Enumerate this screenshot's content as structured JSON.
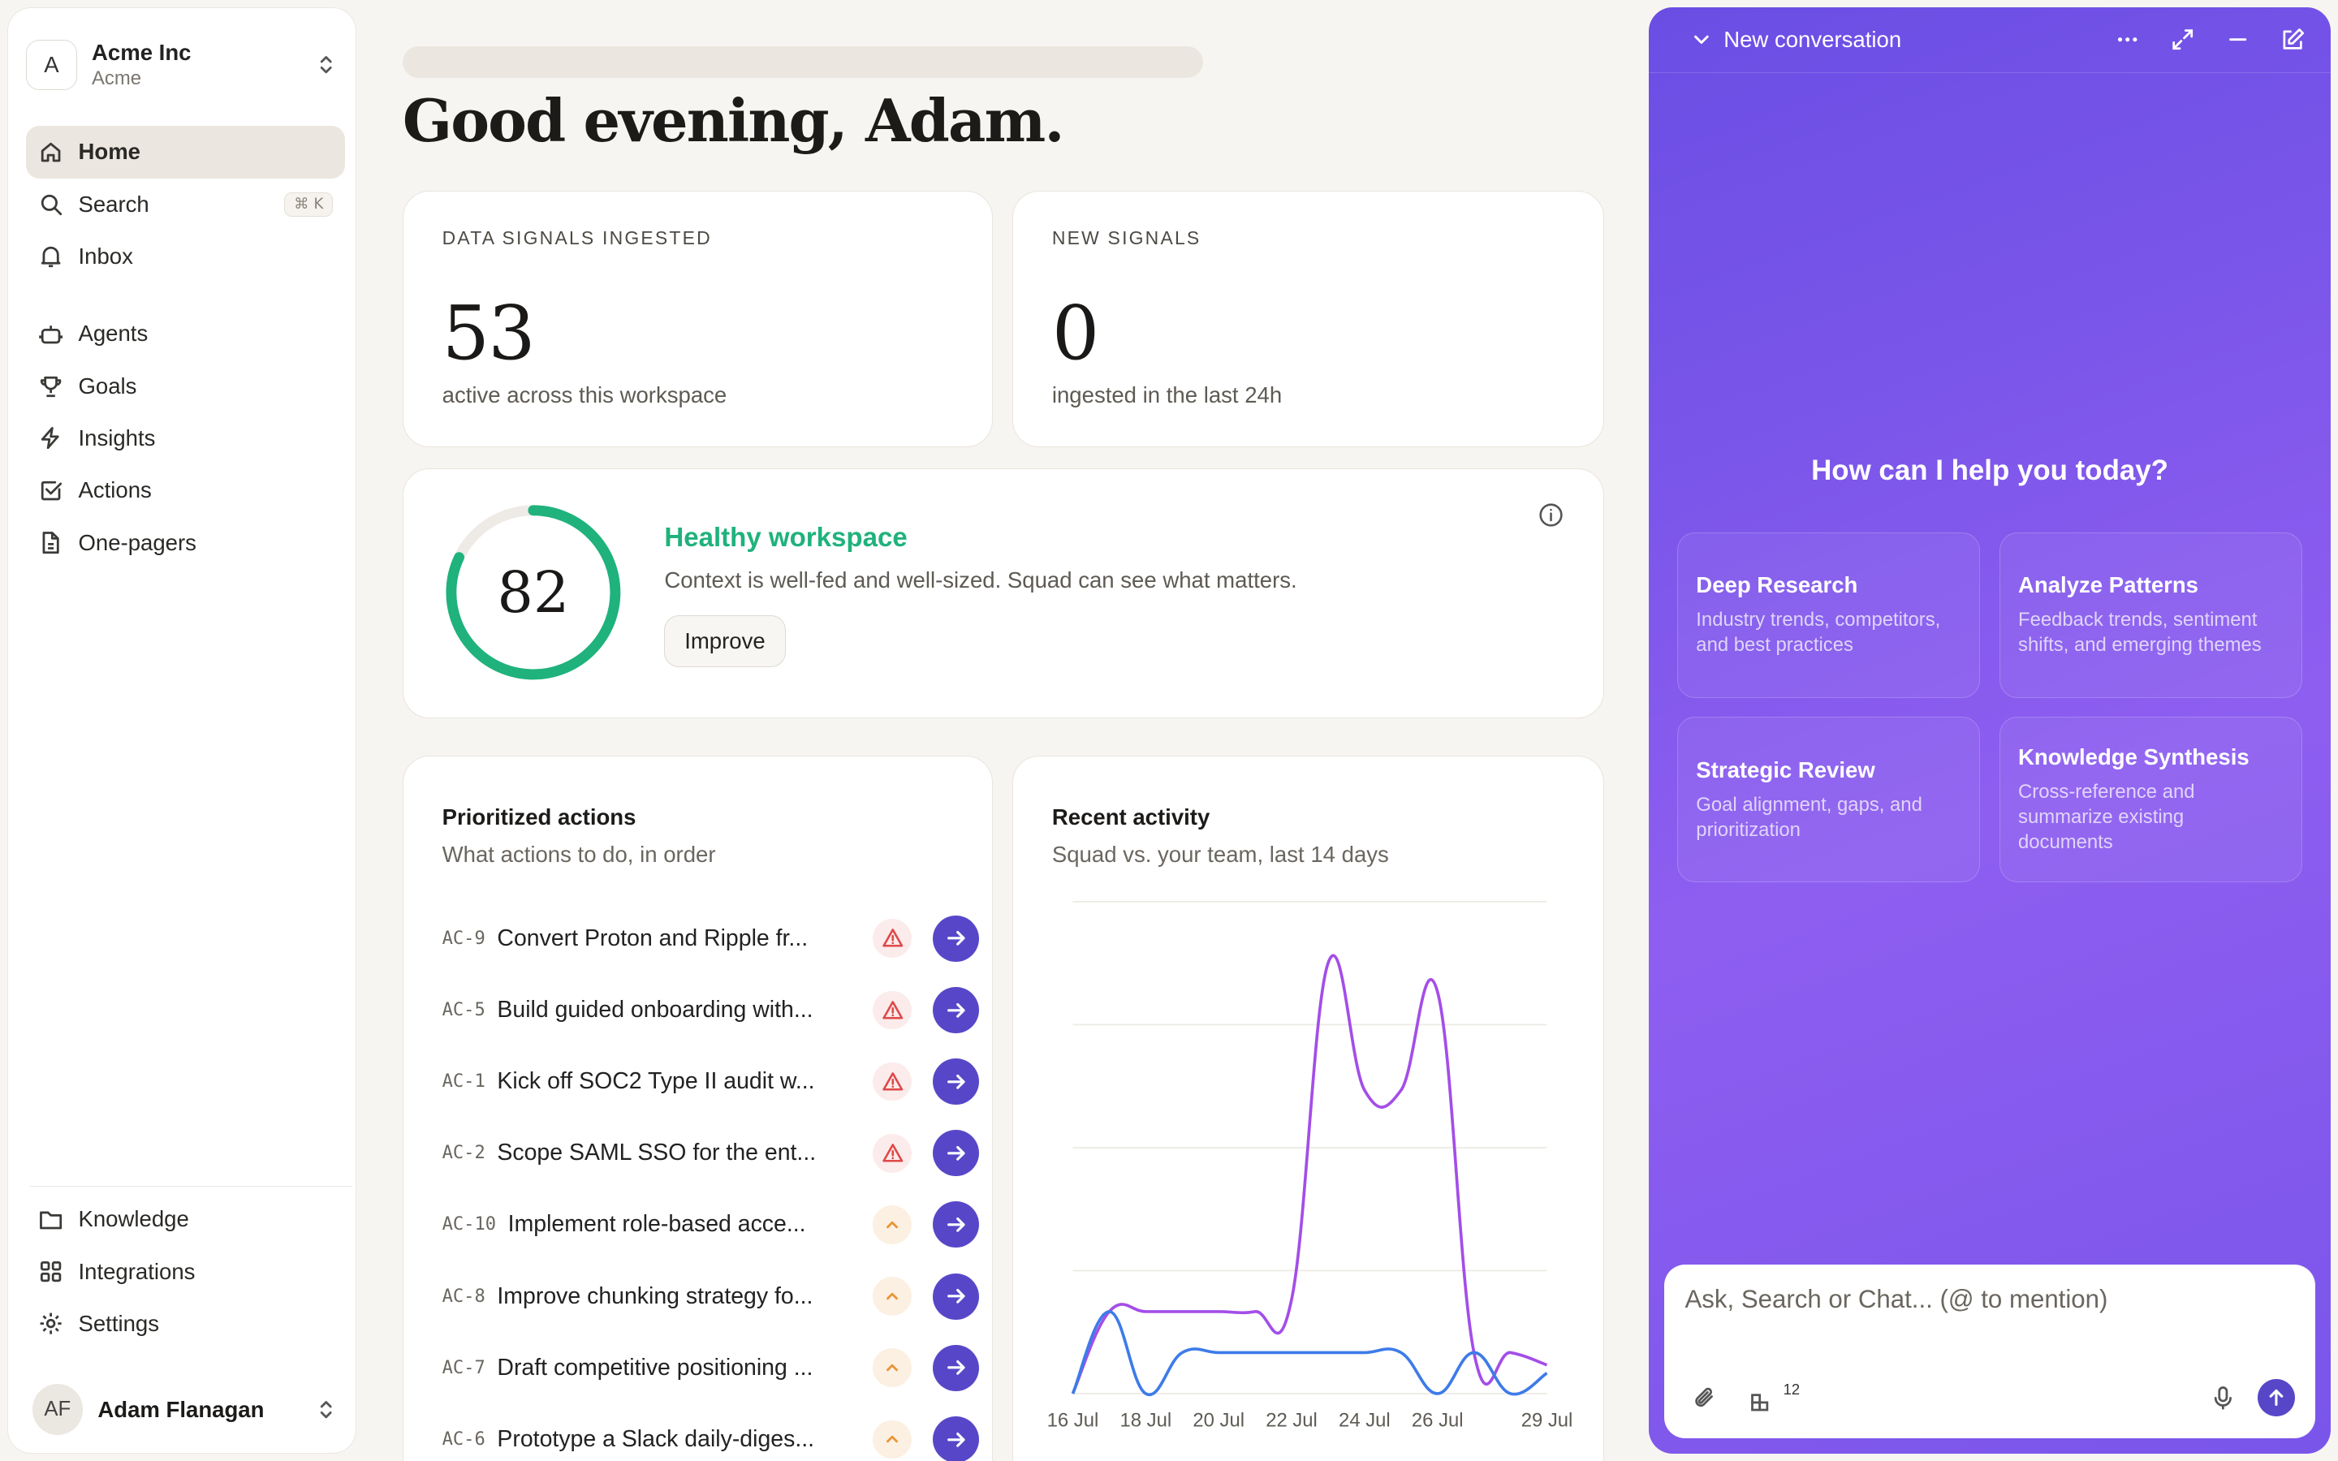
{
  "workspace": {
    "avatar": "A",
    "name": "Acme Inc",
    "sub": "Acme"
  },
  "nav_primary": [
    {
      "label": "Home",
      "icon": "home-icon"
    },
    {
      "label": "Search",
      "icon": "search-icon",
      "shortcut": "⌘ K"
    },
    {
      "label": "Inbox",
      "icon": "bell-icon"
    }
  ],
  "nav_secondary": [
    {
      "label": "Agents",
      "icon": "bot-icon"
    },
    {
      "label": "Goals",
      "icon": "trophy-icon"
    },
    {
      "label": "Insights",
      "icon": "lightning-icon"
    },
    {
      "label": "Actions",
      "icon": "checkbox-icon"
    },
    {
      "label": "One-pagers",
      "icon": "document-icon"
    }
  ],
  "nav_bottom": [
    {
      "label": "Knowledge",
      "icon": "folder-icon"
    },
    {
      "label": "Integrations",
      "icon": "grid-icon"
    },
    {
      "label": "Settings",
      "icon": "gear-icon"
    }
  ],
  "user": {
    "initials": "AF",
    "name": "Adam Flanagan"
  },
  "greeting": "Good evening, Adam.",
  "kpis": {
    "ingested": {
      "label": "DATA SIGNALS INGESTED",
      "value": "53",
      "sub": "active across this workspace"
    },
    "new": {
      "label": "NEW SIGNALS",
      "value": "0",
      "sub": "ingested in the last 24h"
    }
  },
  "health": {
    "score": "82",
    "score_fraction": 0.82,
    "title": "Healthy workspace",
    "desc": "Context is well-fed and well-sized. Squad can see what matters.",
    "button": "Improve",
    "color": "#1fb27d"
  },
  "actions": {
    "title": "Prioritized actions",
    "subtitle": "What actions to do, in order",
    "items": [
      {
        "id": "AC-9",
        "title": "Convert Proton and Ripple fr...",
        "severity": "warning"
      },
      {
        "id": "AC-5",
        "title": "Build guided onboarding with...",
        "severity": "warning"
      },
      {
        "id": "AC-1",
        "title": "Kick off SOC2 Type II audit w...",
        "severity": "warning"
      },
      {
        "id": "AC-2",
        "title": "Scope SAML SSO for the ent...",
        "severity": "warning"
      },
      {
        "id": "AC-10",
        "title": "Implement role-based acce...",
        "severity": "up"
      },
      {
        "id": "AC-8",
        "title": "Improve chunking strategy fo...",
        "severity": "up"
      },
      {
        "id": "AC-7",
        "title": "Draft competitive positioning ...",
        "severity": "up"
      },
      {
        "id": "AC-6",
        "title": "Prototype a Slack daily-diges...",
        "severity": "up"
      }
    ]
  },
  "activity": {
    "title": "Recent activity",
    "subtitle": "Squad vs. your team, last 14 days"
  },
  "chart_data": {
    "type": "line",
    "x": [
      "16 Jul",
      "17 Jul",
      "18 Jul",
      "19 Jul",
      "20 Jul",
      "21 Jul",
      "22 Jul",
      "23 Jul",
      "24 Jul",
      "25 Jul",
      "26 Jul",
      "27 Jul",
      "28 Jul",
      "29 Jul"
    ],
    "tick_labels": [
      "16 Jul",
      "18 Jul",
      "20 Jul",
      "22 Jul",
      "24 Jul",
      "26 Jul",
      "29 Jul"
    ],
    "series": [
      {
        "color": "#a34ee8",
        "values": [
          0,
          2,
          2,
          2,
          2,
          2,
          2.3,
          10.5,
          7.4,
          7.4,
          9.8,
          1,
          1,
          0.7
        ]
      },
      {
        "color": "#3d7be8",
        "values": [
          0,
          2,
          0,
          1,
          1,
          1,
          1,
          1,
          1,
          1,
          0,
          1,
          0,
          0.5
        ]
      }
    ],
    "ylim": [
      0,
      12
    ],
    "grid": true
  },
  "assistant": {
    "title": "New conversation",
    "prompt": "How can I help you today?",
    "suggestions": [
      {
        "title": "Deep Research",
        "desc": "Industry trends, competitors, and best practices"
      },
      {
        "title": "Analyze Patterns",
        "desc": "Feedback trends, sentiment shifts, and emerging themes"
      },
      {
        "title": "Strategic Review",
        "desc": "Goal alignment, gaps, and prioritization"
      },
      {
        "title": "Knowledge Synthesis",
        "desc": "Cross-reference and summarize existing documents"
      }
    ],
    "input_placeholder": "Ask, Search or Chat... (@ to mention)",
    "attachments_count": "12"
  }
}
